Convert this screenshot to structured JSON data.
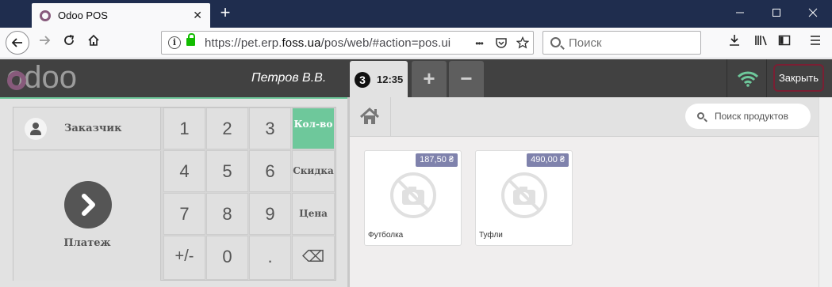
{
  "browser": {
    "tab_title": "Odoo POS",
    "url_prefix": "https://pet.erp.",
    "url_domain": "foss.ua",
    "url_path": "/pos/web/#action=pos.ui",
    "search_placeholder": "Поиск",
    "tab_close_glyph": "✕",
    "new_tab_glyph": "+",
    "more_glyph": "•••"
  },
  "pos": {
    "logo_text": "odoo",
    "cashier": "Петров В.В.",
    "order": {
      "number": "3",
      "time": "12:35"
    },
    "add_order_glyph": "+",
    "remove_order_glyph": "−",
    "close_label": "Закрыть",
    "colors": {
      "accent": "#6ec89b",
      "header": "#414141",
      "price_tag": "#7f82ac",
      "brand": "#875a7b"
    }
  },
  "actionpad": {
    "customer_label": "Заказчик",
    "payment_label": "Платеж"
  },
  "numpad": {
    "keys": [
      "1",
      "2",
      "3",
      "4",
      "5",
      "6",
      "7",
      "8",
      "9",
      "+/-",
      "0",
      "."
    ],
    "modes": {
      "qty": "Кол-во",
      "discount": "Скидка",
      "price": "Цена"
    },
    "backspace_glyph": "⌫"
  },
  "products": {
    "search_placeholder": "Поиск продуктов",
    "items": [
      {
        "name": "Футболка",
        "price": "187,50 ₴"
      },
      {
        "name": "Туфли",
        "price": "490,00 ₴"
      }
    ]
  },
  "icons": {
    "back": "back-arrow-icon",
    "forward": "forward-arrow-icon",
    "reload": "reload-icon",
    "home": "home-icon",
    "info": "info-icon",
    "lock": "lock-icon",
    "pocket": "pocket-icon",
    "bookmark": "star-icon",
    "download": "download-icon",
    "library": "library-icon",
    "sidebar": "sidebar-icon",
    "menu": "hamburger-menu-icon",
    "wifi": "wifi-icon",
    "customer": "user-icon",
    "payment": "chevron-right-icon"
  }
}
